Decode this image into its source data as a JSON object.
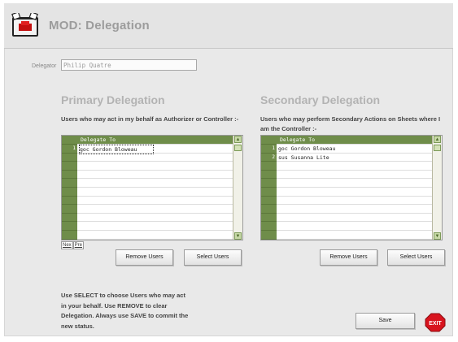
{
  "header": {
    "title": "MOD: Delegation",
    "icon": "app-logo-icon"
  },
  "delegator": {
    "label": "Delegator",
    "value": "Philip Quatre"
  },
  "primary": {
    "title": "Primary Delegation",
    "description": "Users who may act in my behalf as Authorizer or Controller :-",
    "column": "Delegate To",
    "rows": [
      {
        "num": "1",
        "value": "goc Gordon Bloweau"
      }
    ],
    "pager": {
      "next": "Nex",
      "prev": "Pre"
    },
    "remove_label": "Remove Users",
    "select_label": "Select Users"
  },
  "secondary": {
    "title": "Secondary Delegation",
    "description": "Users who may perform Secondary Actions on Sheets where I am the Controller :-",
    "column": "Delegate To",
    "rows": [
      {
        "num": "1",
        "value": "goc Gordon Bloweau"
      },
      {
        "num": "2",
        "value": "sus Susanna Lite"
      }
    ],
    "remove_label": "Remove Users",
    "select_label": "Select Users"
  },
  "help_text": "Use SELECT to choose Users who may act in your behalf. Use REMOVE to clear Delegation. Always use SAVE to commit the new status.",
  "save_label": "Save",
  "exit_label": "EXIT",
  "colors": {
    "grid_header": "#6f8d4a",
    "exit": "#d8141e",
    "title": "#9c9c9c"
  }
}
